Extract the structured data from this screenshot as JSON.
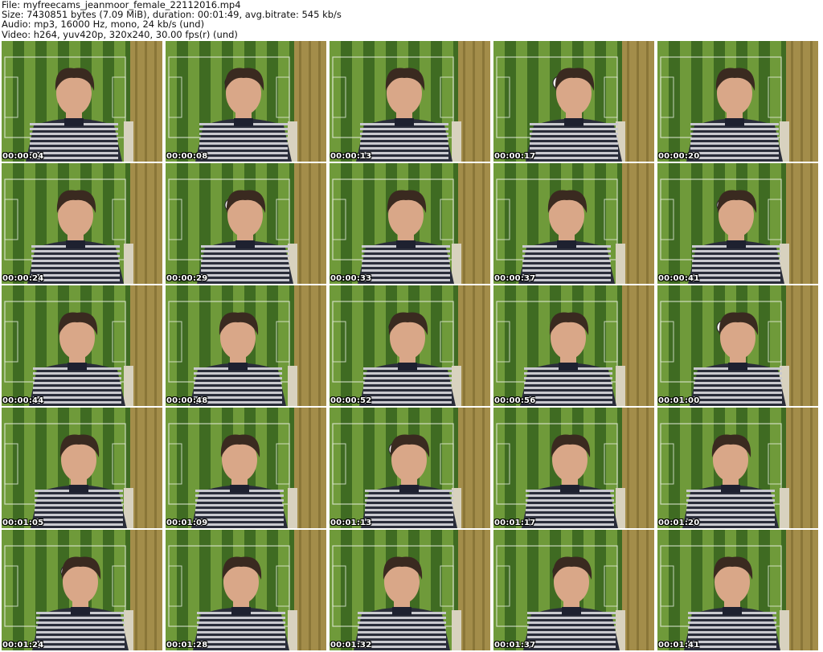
{
  "header": {
    "file_line": "File: myfreecams_jeanmoor_female_22112016.mp4",
    "size_line": "Size: 7430851 bytes (7.09 MiB), duration: 00:01:49, avg.bitrate: 545 kb/s",
    "audio_line": "Audio: mp3, 16000 Hz, mono, 24 kb/s (und)",
    "video_line": "Video: h264, yuv420p, 320x240, 30.00 fps(r) (und)"
  },
  "thumbnails": [
    {
      "timestamp": "00:00:04"
    },
    {
      "timestamp": "00:00:08"
    },
    {
      "timestamp": "00:00:13"
    },
    {
      "timestamp": "00:00:17"
    },
    {
      "timestamp": "00:00:20"
    },
    {
      "timestamp": "00:00:24"
    },
    {
      "timestamp": "00:00:29"
    },
    {
      "timestamp": "00:00:33"
    },
    {
      "timestamp": "00:00:37"
    },
    {
      "timestamp": "00:00:41"
    },
    {
      "timestamp": "00:00:44"
    },
    {
      "timestamp": "00:00:48"
    },
    {
      "timestamp": "00:00:52"
    },
    {
      "timestamp": "00:00:56"
    },
    {
      "timestamp": "00:01:00"
    },
    {
      "timestamp": "00:01:05"
    },
    {
      "timestamp": "00:01:09"
    },
    {
      "timestamp": "00:01:13"
    },
    {
      "timestamp": "00:01:17"
    },
    {
      "timestamp": "00:01:20"
    },
    {
      "timestamp": "00:01:24"
    },
    {
      "timestamp": "00:01:28"
    },
    {
      "timestamp": "00:01:32"
    },
    {
      "timestamp": "00:01:37"
    },
    {
      "timestamp": "00:01:41"
    }
  ],
  "colors": {
    "pitch_dark": "#3f6b22",
    "pitch_light": "#6f9a3a",
    "curtain": "#a38d4a",
    "wall": "#d8d2bf",
    "sweater_dark": "#2a2d3a",
    "sweater_light": "#c9c9cf",
    "skin": "#d9a788",
    "hair": "#3a2a20"
  }
}
